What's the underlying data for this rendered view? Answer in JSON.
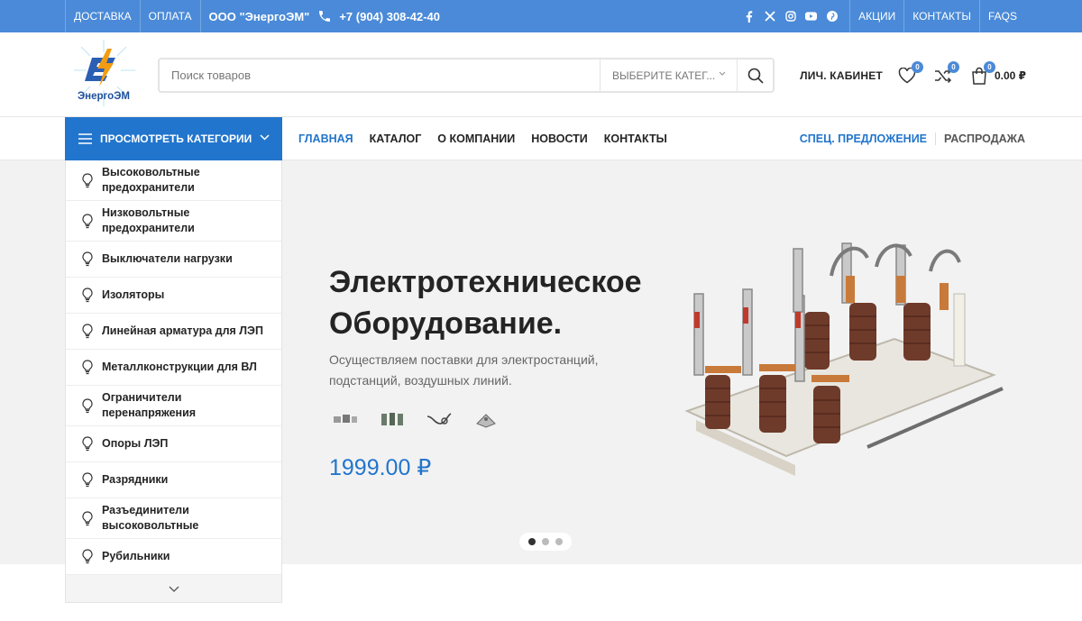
{
  "topbar": {
    "links_left": [
      "Доставка",
      "Оплата"
    ],
    "company": "ООО \"ЭнергоЭМ\"",
    "phone": "+7 (904) 308-42-40",
    "socials": [
      "facebook-icon",
      "x-icon",
      "instagram-icon",
      "youtube-icon",
      "pinterest-icon"
    ],
    "links_right": [
      "Акции",
      "Контакты",
      "FAQs"
    ]
  },
  "header": {
    "logo_text": "ЭнергоЭМ",
    "search_placeholder": "Поиск товаров",
    "category_select": "Выберите катег...",
    "account": "Лич. кабинет",
    "wishlist_count": "0",
    "compare_count": "0",
    "cart_count": "0",
    "cart_total": "0.00 ₽"
  },
  "nav": {
    "browse": "Просмотреть категории",
    "items": [
      "Главная",
      "Каталог",
      "О компании",
      "Новости",
      "Контакты"
    ],
    "special": "Спец. предложение",
    "sale": "Распродажа"
  },
  "categories": [
    "Высоковольтные предохранители",
    "Низковольтные предохранители",
    "Выключатели нагрузки",
    "Изоляторы",
    "Линейная арматура для ЛЭП",
    "Металлконструкции для ВЛ",
    "Ограничители перенапряжения",
    "Опоры ЛЭП",
    "Разрядники",
    "Разъединители высоковольтные",
    "Рубильники"
  ],
  "hero": {
    "title_line1": "Электротехническое",
    "title_line2": "Оборудование.",
    "subtitle": "Осуществляем поставки для электростанций, подстанций, воздушных линий.",
    "price": "1999.00 ₽",
    "slides": 3,
    "active_slide": 1
  },
  "colors": {
    "topbar": "#4a8ad8",
    "accent": "#2275cc",
    "hero_bg": "#f2f2f2"
  }
}
